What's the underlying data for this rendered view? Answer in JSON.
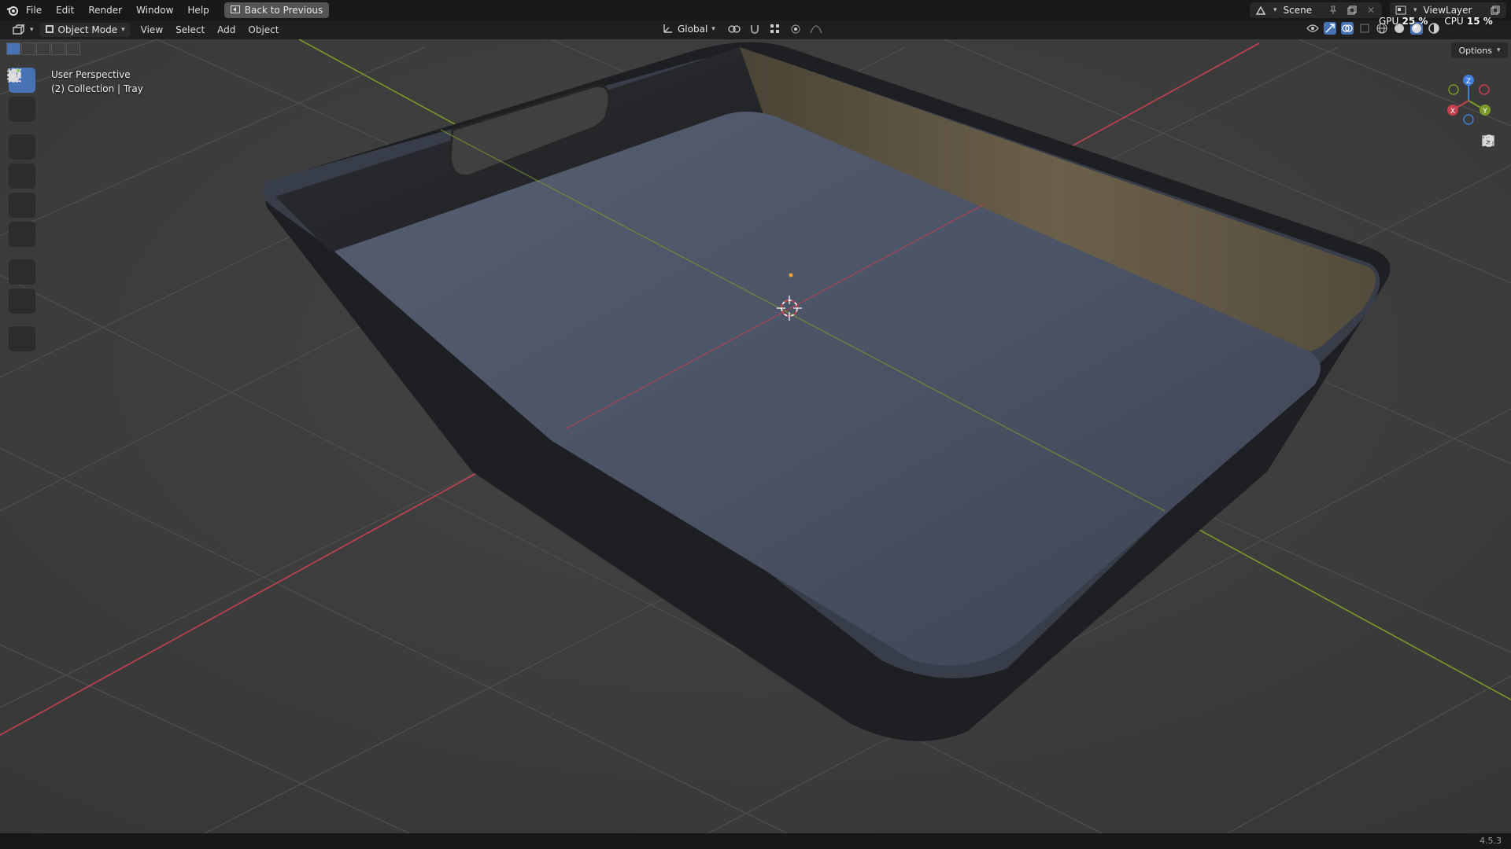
{
  "topbar": {
    "menus": [
      "File",
      "Edit",
      "Render",
      "Window",
      "Help"
    ],
    "back_label": "Back to Previous"
  },
  "header": {
    "mode_label": "Object Mode",
    "menus": [
      "View",
      "Select",
      "Add",
      "Object"
    ],
    "transform_orientation": "Global"
  },
  "scene": {
    "name": "Scene"
  },
  "view_layer": {
    "name": "ViewLayer"
  },
  "perf": {
    "gpu_label": "GPU",
    "gpu_value": "25 %",
    "cpu_label": "CPU",
    "cpu_value": "15 %"
  },
  "viewport": {
    "perspective_label": "User Perspective",
    "collection_label": "(2) Collection | Tray",
    "options_label": "Options"
  },
  "gizmo": {
    "z": "Z",
    "x": "X",
    "y": "Y"
  },
  "toolbar": {
    "tools": [
      "select-box-icon",
      "cursor-icon",
      "move-icon",
      "rotate-icon",
      "scale-icon",
      "transform-icon",
      "annotate-icon",
      "measure-icon",
      "add-cube-icon"
    ],
    "active": "select-box-icon"
  },
  "status": {
    "version": "4.5.3"
  },
  "colors": {
    "accent": "#4772b3",
    "axis_x": "#c5414f",
    "axis_y": "#7a9a2a",
    "axis_z": "#3f7fe0",
    "tray_top": "#4d5566",
    "tray_side": "#26272a"
  }
}
